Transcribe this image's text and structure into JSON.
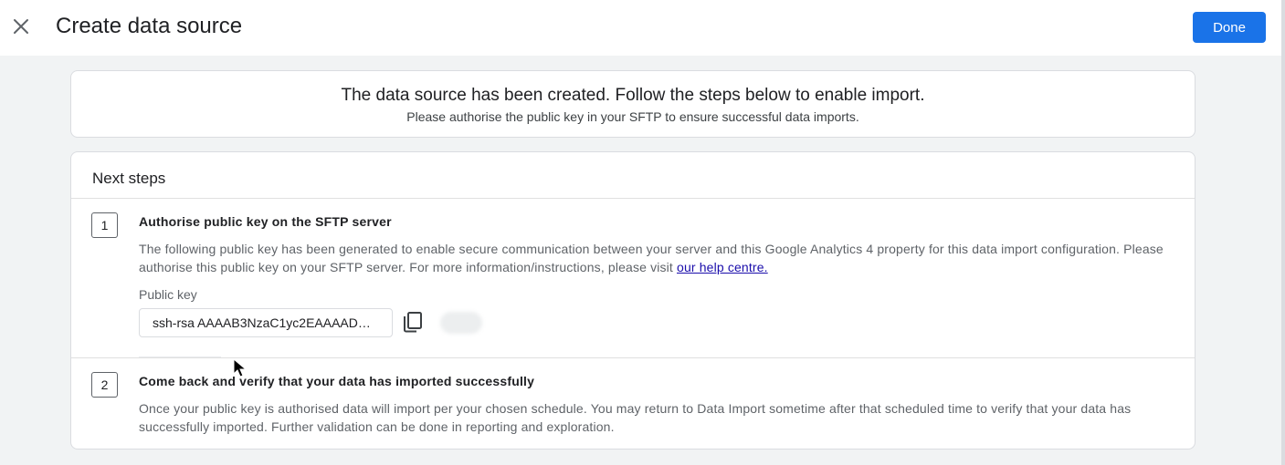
{
  "header": {
    "title": "Create data source",
    "close_icon": "close-icon",
    "done_label": "Done"
  },
  "banner": {
    "title": "The data source has been created. Follow the steps below to enable import.",
    "subtitle": "Please authorise the public key in your SFTP to ensure successful data imports."
  },
  "next_steps": {
    "title": "Next steps",
    "steps": [
      {
        "number": "1",
        "heading": "Authorise public key on the SFTP server",
        "body": "The following public key has been generated to enable secure communication between your server and this Google Analytics 4 property for this data import configuration. Please authorise this public key on your SFTP server. For more information/instructions, please visit ",
        "link": "our help centre.",
        "public_key_label": "Public key",
        "public_key_value": "ssh-rsa AAAAB3NzaC1yc2EAAAADAQ...",
        "copy_icon": "copy-icon"
      },
      {
        "number": "2",
        "heading": "Come back and verify that your data has imported successfully",
        "body": "Once your public key is authorised data will import per your chosen schedule. You may return to Data Import sometime after that scheduled time to verify that your data has successfully imported. Further validation can be done in reporting and exploration."
      }
    ]
  },
  "colors": {
    "accent": "#1a73e8",
    "link": "#1a0dab",
    "background": "#f1f3f4"
  }
}
